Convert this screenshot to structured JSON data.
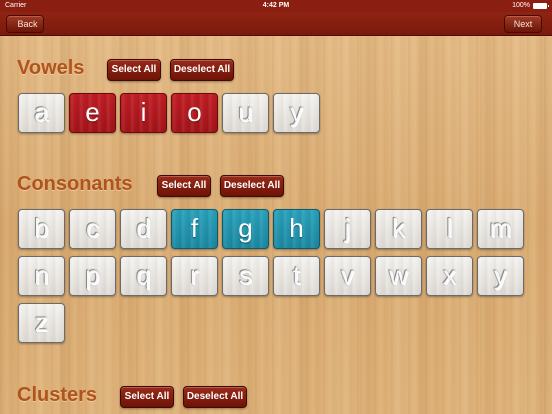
{
  "status_bar": {
    "carrier": "Carrier",
    "time": "4:42 PM",
    "battery": "100%"
  },
  "nav": {
    "back_label": "Back",
    "next_label": "Next"
  },
  "vowels": {
    "title": "Vowels",
    "select_all": "Select All",
    "deselect_all": "Deselect All",
    "tiles": [
      {
        "letter": "a",
        "selected": false
      },
      {
        "letter": "e",
        "selected": true
      },
      {
        "letter": "i",
        "selected": true
      },
      {
        "letter": "o",
        "selected": true
      },
      {
        "letter": "u",
        "selected": false
      },
      {
        "letter": "y",
        "selected": false
      }
    ]
  },
  "consonants": {
    "title": "Consonants",
    "select_all": "Select All",
    "deselect_all": "Deselect All",
    "tiles": [
      {
        "letter": "b",
        "selected": false
      },
      {
        "letter": "c",
        "selected": false
      },
      {
        "letter": "d",
        "selected": false
      },
      {
        "letter": "f",
        "selected": true
      },
      {
        "letter": "g",
        "selected": true
      },
      {
        "letter": "h",
        "selected": true
      },
      {
        "letter": "j",
        "selected": false
      },
      {
        "letter": "k",
        "selected": false
      },
      {
        "letter": "l",
        "selected": false
      },
      {
        "letter": "m",
        "selected": false
      },
      {
        "letter": "n",
        "selected": false
      },
      {
        "letter": "p",
        "selected": false
      },
      {
        "letter": "q",
        "selected": false
      },
      {
        "letter": "r",
        "selected": false
      },
      {
        "letter": "s",
        "selected": false
      },
      {
        "letter": "t",
        "selected": false
      },
      {
        "letter": "v",
        "selected": false
      },
      {
        "letter": "w",
        "selected": false
      },
      {
        "letter": "x",
        "selected": false
      },
      {
        "letter": "y",
        "selected": false
      },
      {
        "letter": "z",
        "selected": false
      }
    ]
  },
  "clusters": {
    "title": "Clusters",
    "select_all": "Select All",
    "deselect_all": "Deselect All"
  },
  "colors": {
    "vowel_selected": "#b31a20",
    "consonant_selected": "#2497b1",
    "nav_bar": "#86200f",
    "title_text": "#b0541e"
  }
}
